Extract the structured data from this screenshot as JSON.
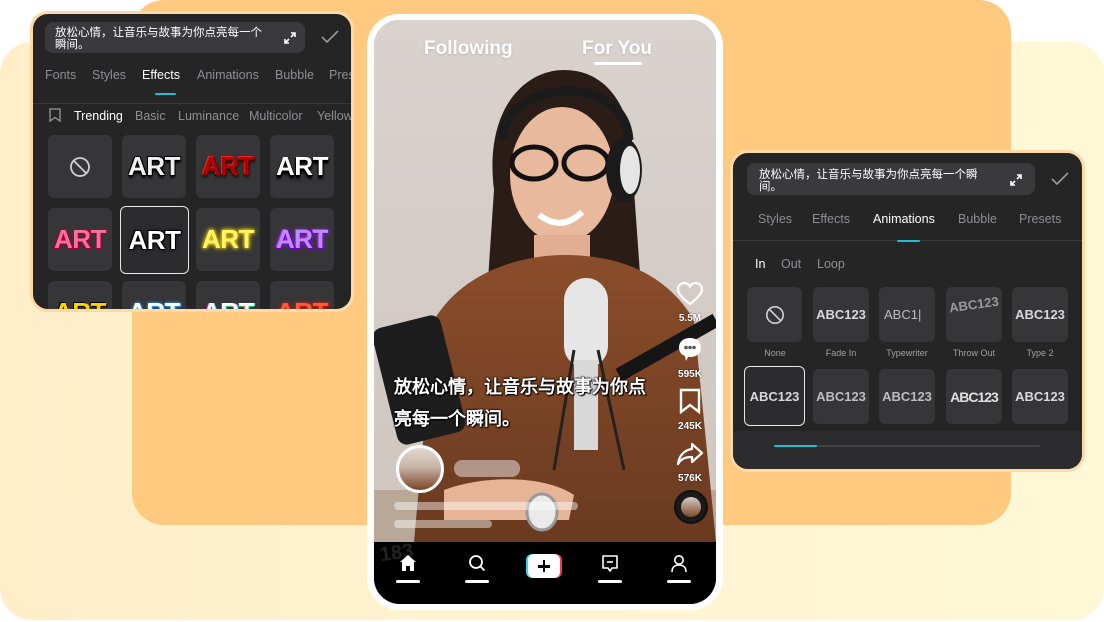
{
  "caption_text": "放松心情，让音乐与故事为你点亮每一个瞬间。",
  "left_panel": {
    "tabs": [
      "Fonts",
      "Styles",
      "Effects",
      "Animations",
      "Bubble",
      "Presets"
    ],
    "active_tab": "Effects",
    "subtabs": [
      "Trending",
      "Basic",
      "Luminance",
      "Multicolor",
      "Yellow"
    ],
    "active_subtab": "Trending",
    "effect_tiles": [
      {
        "label": "none",
        "icon": "prohibit-icon"
      },
      {
        "label": "ART",
        "style": "silver"
      },
      {
        "label": "ART",
        "style": "red"
      },
      {
        "label": "ART",
        "style": "white-shadow"
      },
      {
        "label": "ART",
        "style": "pink"
      },
      {
        "label": "ART",
        "style": "white-outline",
        "selected": true
      },
      {
        "label": "ART",
        "style": "yellow-glow"
      },
      {
        "label": "ART",
        "style": "purple"
      },
      {
        "label": "ART",
        "style": "yellow-black"
      },
      {
        "label": "ART",
        "style": "blue"
      },
      {
        "label": "ART",
        "style": "rainbow"
      },
      {
        "label": "ART",
        "style": "red-glow"
      }
    ]
  },
  "right_panel": {
    "tabs": [
      "Fonts",
      "Styles",
      "Effects",
      "Animations",
      "Bubble",
      "Presets"
    ],
    "active_tab": "Animations",
    "subtabs": [
      "In",
      "Out",
      "Loop"
    ],
    "active_subtab": "In",
    "animation_tiles": [
      {
        "label": "None",
        "preview": ""
      },
      {
        "label": "Fade In",
        "preview": "ABC123"
      },
      {
        "label": "Typewriter",
        "preview": "ABC1|"
      },
      {
        "label": "Throw Out",
        "preview": "ABC123"
      },
      {
        "label": "Type 2",
        "preview": "ABC123"
      },
      {
        "label": "",
        "preview": "ABC123",
        "selected": true
      },
      {
        "label": "",
        "preview": "ABC123"
      },
      {
        "label": "",
        "preview": "ABC123"
      },
      {
        "label": "",
        "preview": "ABC123"
      },
      {
        "label": "",
        "preview": "ABC123"
      }
    ],
    "scroll_progress": 0.16
  },
  "phone": {
    "feed_tabs": [
      "Following",
      "For You"
    ],
    "active_feed_tab": "For You",
    "caption": "放松心情，让音乐与故事为你点亮每一个瞬间。",
    "actions": [
      {
        "icon": "heart-icon",
        "count": "5.5M"
      },
      {
        "icon": "comment-icon",
        "count": "595K"
      },
      {
        "icon": "bookmark-icon",
        "count": "245K"
      },
      {
        "icon": "share-icon",
        "count": "576K"
      }
    ],
    "nav": [
      "home-icon",
      "search-icon",
      "create-icon",
      "inbox-icon",
      "profile-icon"
    ],
    "watermark": "183"
  },
  "colors": {
    "accent": "#1fbfd3",
    "orange_bg": "#ffca80",
    "pale_bg": "#fff3d2",
    "panel_bg": "#252525"
  }
}
